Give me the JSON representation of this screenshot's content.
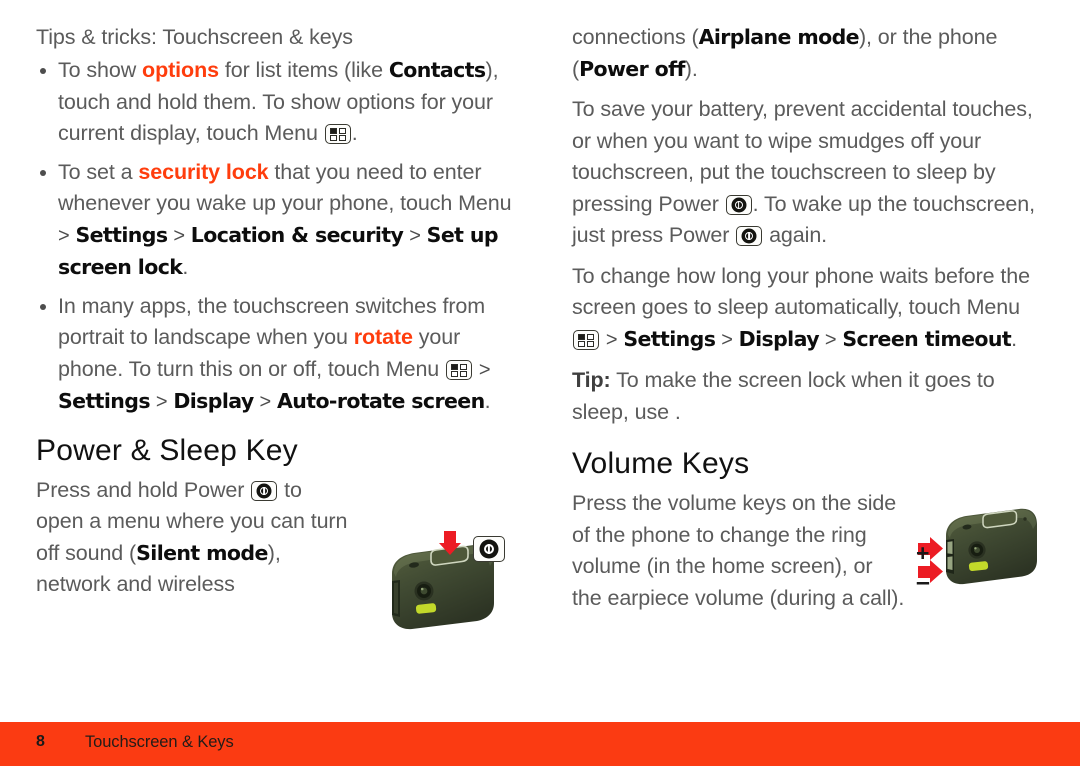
{
  "page": {
    "accent_color": "#ff3d0d",
    "footer_bar_color": "#fb3b12",
    "body_text_color": "#5b5b5b"
  },
  "left_column": {
    "lead": "Tips & tricks: Touchscreen & keys",
    "bullets": [
      {
        "seg1": "To show ",
        "hl1": "options",
        "seg2": " for list items (like ",
        "ui1": "Contacts",
        "seg3": "), touch and hold them. To show options for your current display, touch Menu ",
        "icon": "menu-icon",
        "seg4": "."
      },
      {
        "seg1": "To set a ",
        "hl1": "security lock",
        "seg2": " that you need to enter whenever you wake up your phone, touch Menu ",
        "sep1": ">",
        "ui1": "Settings",
        "sep2": ">",
        "ui2": "Location & security",
        "sep3": ">",
        "ui3": "Set up screen lock",
        "seg3": "."
      },
      {
        "seg1": "In many apps, the touchscreen switches from portrait to landscape when you ",
        "hl1": "rotate",
        "seg2": " your phone. To turn this on or off, touch Menu ",
        "icon": "menu-icon",
        "sep1": ">",
        "ui1": "Settings",
        "sep2": ">",
        "ui2": "Display",
        "sep3": ">",
        "ui3": "Auto-rotate screen",
        "seg3": "."
      }
    ],
    "power_sleep": {
      "heading": "Power & Sleep Key",
      "body_seg1": "Press and hold Power ",
      "body_icon": "power-icon",
      "body_seg2": " to open a menu where you can turn off sound (",
      "body_ui1": "Silent mode",
      "body_seg3": "), network and wireless"
    },
    "figure_power": {
      "name": "phone-back-power-key-illustration",
      "arrow_color": "#ec1c24",
      "body_color": "#3f4a33",
      "flash_color": "#c8dd28",
      "callout_icon": "power-icon"
    }
  },
  "right_column": {
    "continuation": {
      "seg1": "connections (",
      "ui1": "Airplane mode",
      "seg2": "), or the phone (",
      "ui2": "Power off",
      "seg3": ")."
    },
    "sleep_para": {
      "seg1": "To save your battery, prevent accidental touches, or when you want to wipe smudges off your touchscreen, put the touchscreen to sleep by pressing Power ",
      "icon1": "power-icon",
      "seg2": ". To wake up the touchscreen, just press Power ",
      "icon2": "power-icon",
      "seg3": " again."
    },
    "timeout_para": {
      "seg1": "To change how long your phone waits before the screen goes to sleep automatically, touch Menu ",
      "icon": "menu-icon",
      "sep1": ">",
      "ui1": "Settings",
      "sep2": ">",
      "ui2": "Display",
      "sep3": ">",
      "ui3": "Screen timeout",
      "seg2": "."
    },
    "tip": {
      "label": "Tip:",
      "text": " To make the screen lock when it goes to sleep, use ."
    },
    "volume_keys": {
      "heading": "Volume Keys",
      "body": "Press the volume keys on the side of the phone to change the ring volume (in the home screen), or the earpiece volume (during a call)."
    },
    "figure_volume": {
      "name": "phone-side-volume-keys-illustration",
      "arrow_color": "#ec1c24",
      "body_color": "#3f4a33",
      "flash_color": "#c8dd28",
      "plus_label": "+",
      "minus_label": "–"
    }
  },
  "footer": {
    "page_number": "8",
    "title": "Touchscreen & Keys"
  }
}
